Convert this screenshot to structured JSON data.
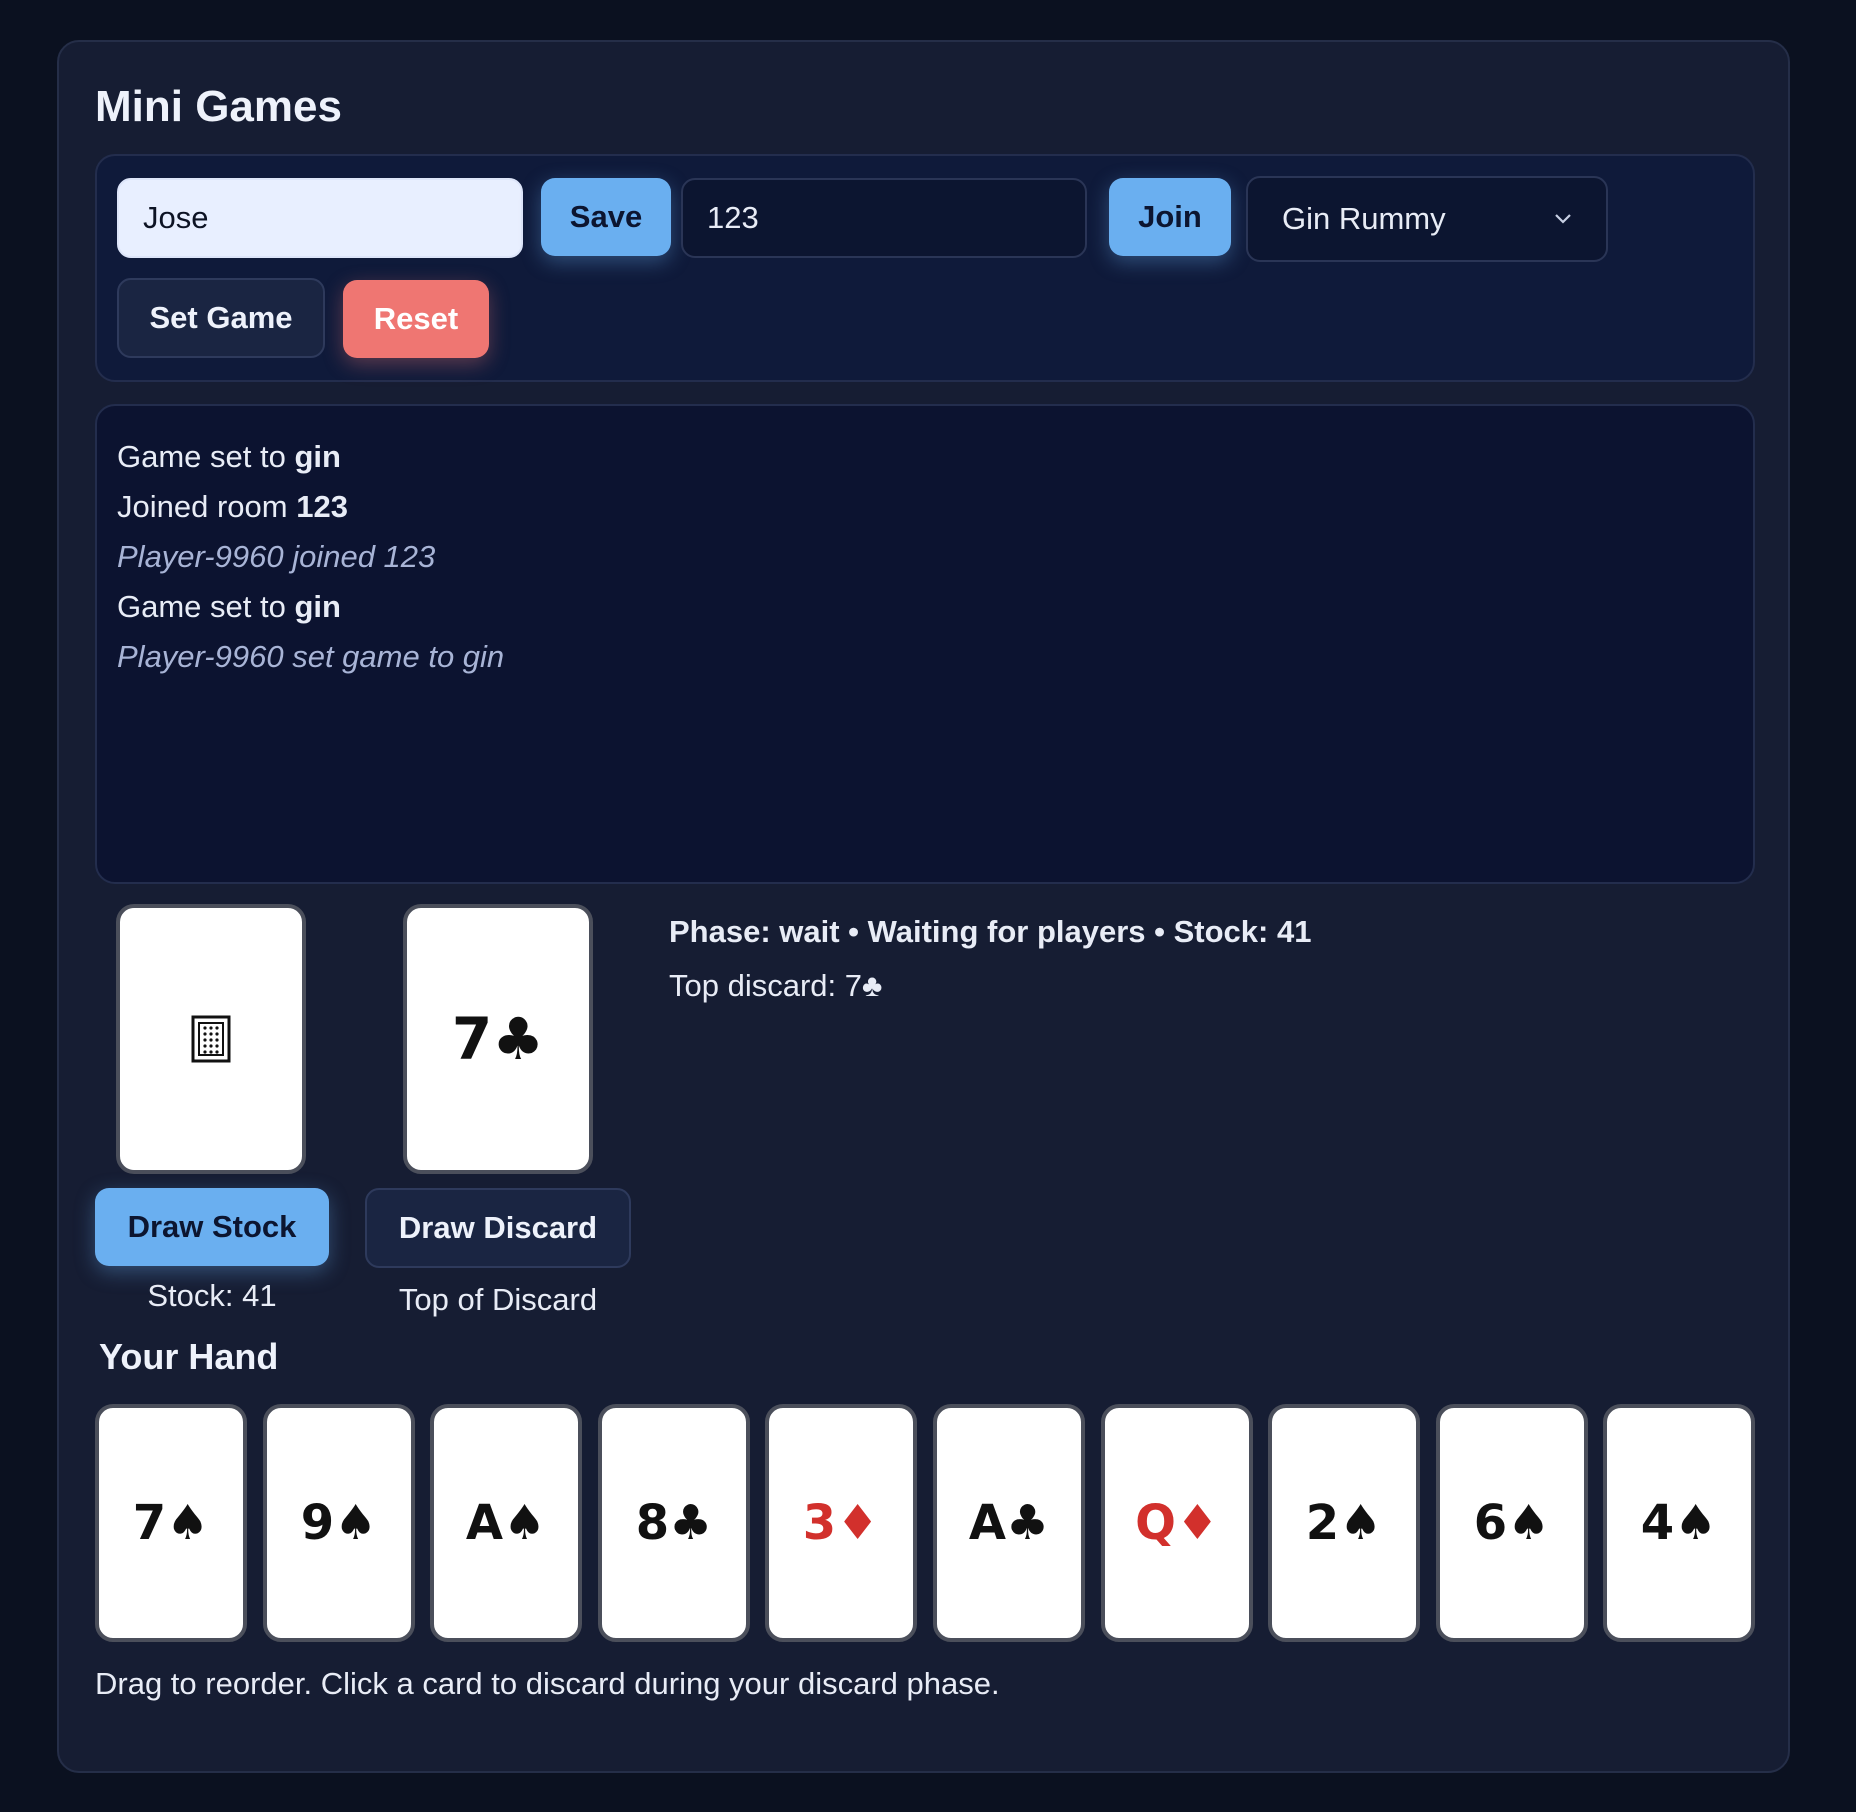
{
  "app": {
    "title": "Mini Games"
  },
  "controls": {
    "name_value": "Jose",
    "save_label": "Save",
    "room_value": "123",
    "join_label": "Join",
    "game_select_value": "Gin Rummy",
    "set_game_label": "Set Game",
    "reset_label": "Reset"
  },
  "log": {
    "lines": [
      {
        "text": "Game set to ",
        "bold": "gin",
        "style": "normal"
      },
      {
        "text": "Joined room ",
        "bold": "123",
        "style": "normal"
      },
      {
        "text": "Player-9960 joined 123",
        "bold": "",
        "style": "italic"
      },
      {
        "text": "Game set to ",
        "bold": "gin",
        "style": "normal"
      },
      {
        "text": "Player-9960 set game to gin",
        "bold": "",
        "style": "italic"
      }
    ]
  },
  "table": {
    "stock_card_glyph": "🂠",
    "discard_card": "7♣",
    "draw_stock_label": "Draw Stock",
    "draw_discard_label": "Draw Discard",
    "stock_caption": "Stock: 41",
    "discard_caption": "Top of Discard",
    "status": "Phase: wait • Waiting for players • Stock: 41",
    "top_discard": "Top discard: 7♣"
  },
  "hand": {
    "title": "Your Hand",
    "cards": [
      {
        "label": "7♠",
        "color": "black"
      },
      {
        "label": "9♠",
        "color": "black"
      },
      {
        "label": "A♠",
        "color": "black"
      },
      {
        "label": "8♣",
        "color": "black"
      },
      {
        "label": "3♦",
        "color": "red"
      },
      {
        "label": "A♣",
        "color": "black"
      },
      {
        "label": "Q♦",
        "color": "red"
      },
      {
        "label": "2♠",
        "color": "black"
      },
      {
        "label": "6♠",
        "color": "black"
      },
      {
        "label": "4♠",
        "color": "black"
      }
    ],
    "hint": "Drag to reorder. Click a card to discard during your discard phase."
  },
  "colors": {
    "background": "#0b1120",
    "panel": "#161d33",
    "accent_blue": "#6aaff0",
    "danger_red": "#ef7672",
    "red_suit": "#d2302c"
  }
}
